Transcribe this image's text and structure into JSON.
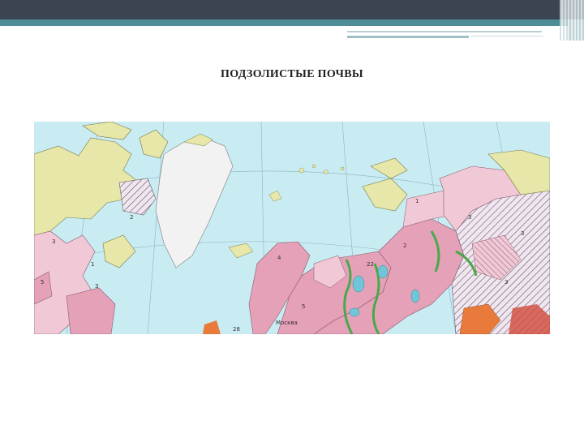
{
  "slide": {
    "title": "ПОДЗОЛИСТЫЕ ПОЧВЫ"
  },
  "map": {
    "city_label": "Москва",
    "region_numbers": [
      "5",
      "3",
      "1",
      "2",
      "3",
      "4",
      "5",
      "3",
      "1",
      "2",
      "3",
      "3",
      "22",
      "28"
    ],
    "colors": {
      "ocean": "#c8ecf2",
      "tundra": "#e6e7a8",
      "ice": "#f2f2f2",
      "podzol_pink": "#e4a1b8",
      "podzol_light": "#f0c8d6",
      "forest_green": "#4aa84a",
      "lakes": "#6fc6d6",
      "orange": "#e87a3c"
    }
  }
}
